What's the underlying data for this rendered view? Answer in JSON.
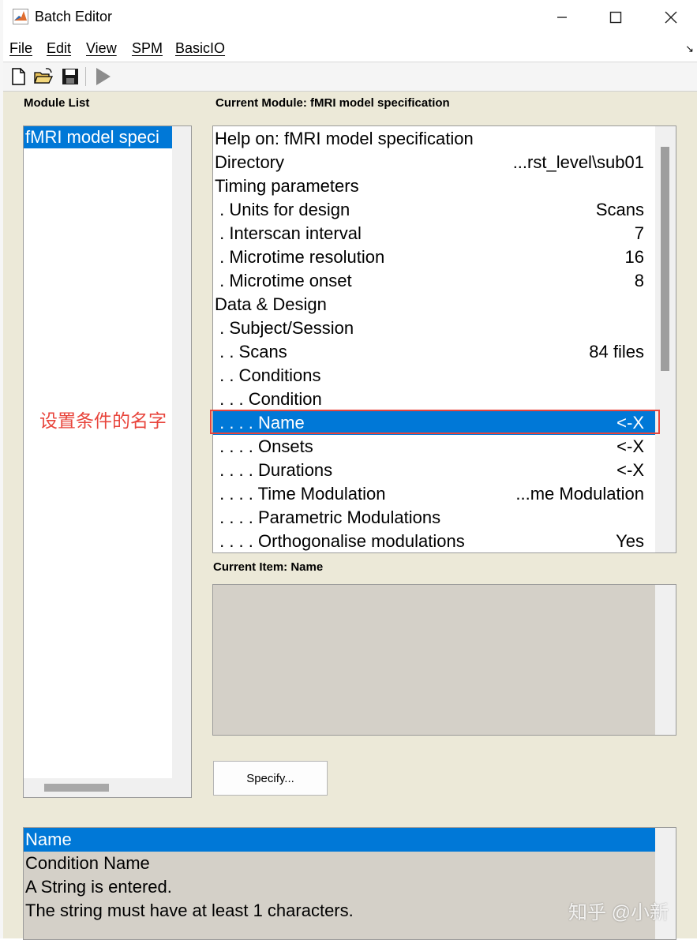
{
  "window": {
    "title": "Batch Editor",
    "minimize_icon": "minimize-icon",
    "maximize_icon": "maximize-icon",
    "close_icon": "close-icon"
  },
  "menu": {
    "items": [
      "File",
      "Edit",
      "View",
      "SPM",
      "BasicIO"
    ]
  },
  "toolbar": {
    "icons": [
      "new-file-icon",
      "open-folder-icon",
      "save-icon",
      "run-icon"
    ]
  },
  "module_list": {
    "label": "Module List",
    "items": [
      "fMRI model speci"
    ]
  },
  "current_module": {
    "label": "Current Module: fMRI model specification",
    "rows": [
      {
        "label": "Help on: fMRI model specification",
        "value": ""
      },
      {
        "label": "Directory",
        "value": "...rst_level\\sub01"
      },
      {
        "label": "Timing parameters",
        "value": ""
      },
      {
        "label": " . Units for design",
        "value": "Scans"
      },
      {
        "label": " . Interscan interval",
        "value": "7"
      },
      {
        "label": " . Microtime resolution",
        "value": "16"
      },
      {
        "label": " . Microtime onset",
        "value": "8"
      },
      {
        "label": "Data & Design",
        "value": ""
      },
      {
        "label": " . Subject/Session",
        "value": ""
      },
      {
        "label": " . . Scans",
        "value": "84 files"
      },
      {
        "label": " . . Conditions",
        "value": ""
      },
      {
        "label": " . . . Condition",
        "value": ""
      },
      {
        "label": " . . . . Name",
        "value": "<-X"
      },
      {
        "label": " . . . . Onsets",
        "value": "<-X"
      },
      {
        "label": " . . . . Durations",
        "value": "<-X"
      },
      {
        "label": " . . . . Time Modulation",
        "value": "...me Modulation"
      },
      {
        "label": " . . . . Parametric Modulations",
        "value": ""
      },
      {
        "label": " . . . . Orthogonalise modulations",
        "value": "Yes"
      }
    ],
    "selected_index": 12
  },
  "annotation": {
    "text": "设置条件的名字",
    "color": "#e8453c"
  },
  "current_item": {
    "label": "Current Item: Name"
  },
  "specify_button": {
    "label": "Specify..."
  },
  "help": {
    "lines": [
      "Name",
      "Condition Name",
      "A String is entered.",
      "The string must have at least 1 characters."
    ]
  },
  "watermark": {
    "text": "知乎 @小新"
  },
  "colors": {
    "selection": "#0078d7",
    "panel_bg": "#ece9d8",
    "annotation": "#e8453c"
  }
}
